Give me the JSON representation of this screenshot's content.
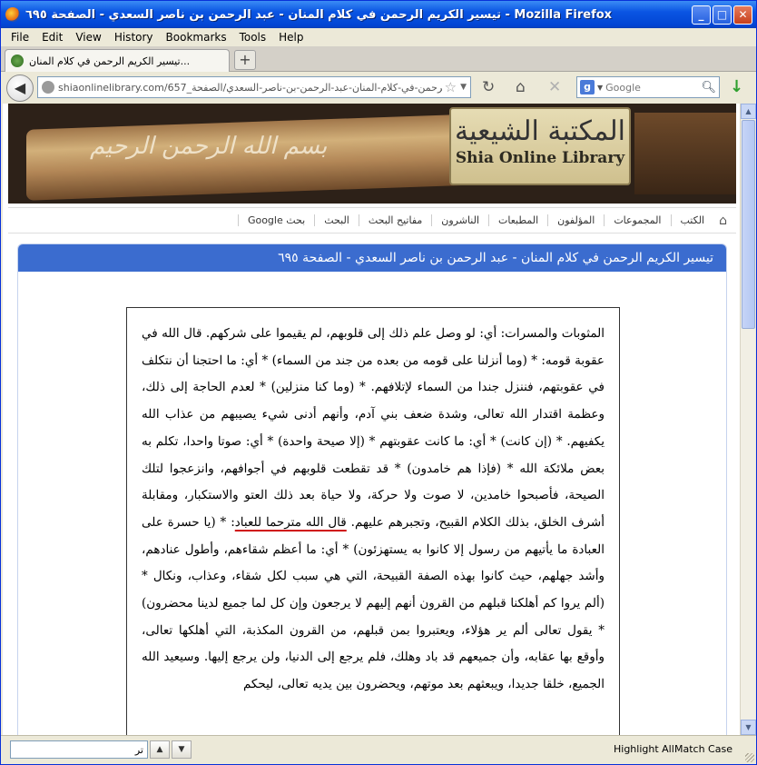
{
  "window": {
    "title": "تيسير الكريم الرحمن في كلام المنان - عبد الرحمن بن ناصر السعدي - الصفحة ٦٩٥ - Mozilla Firefox",
    "min_label": "_",
    "max_label": "□",
    "close_label": "✕"
  },
  "menubar": {
    "items": [
      "File",
      "Edit",
      "View",
      "History",
      "Bookmarks",
      "Tools",
      "Help"
    ]
  },
  "tabs": {
    "active_title": "تيسير الكريم الرحمن في كلام المنان...",
    "new_tab_label": "+"
  },
  "navbar": {
    "url": "shiaonlinelibrary.com/657_تيسير-الكريم-الرحمن-في-كلام-المنان-عبد-الرحمن-بن-ناصر-السعدي/الصفحة",
    "search_placeholder": "Google",
    "search_engine_letter": "g"
  },
  "banner": {
    "calligraphy": "بسم الله الرحمن الرحيم",
    "logo_arabic": "المكتبة الشيعية",
    "logo_english": "Shia Online Library"
  },
  "sitenav": {
    "items": [
      "الكتب",
      "المجموعات",
      "المؤلفون",
      "المطبعات",
      "الناشرون",
      "مفاتيح البحث",
      "البحث",
      "بحث Google"
    ]
  },
  "page": {
    "header": "تيسير الكريم الرحمن في كلام المنان - عبد الرحمن بن ناصر السعدي - الصفحة ٦٩٥",
    "text_before": "المثوبات والمسرات: أي: لو وصل علم ذلك إلى قلوبهم، لم يقيموا على شركهم. قال الله في عقوبة قومه: * (وما أنزلنا على قومه من بعده من جند من السماء) * أي: ما احتجنا أن نتكلف في عقوبتهم، فننزل جندا من السماء لإتلافهم. * (وما كنا منزلين) * لعدم الحاجة إلى ذلك، وعظمة اقتدار الله تعالى، وشدة ضعف بني آدم، وأنهم أدنى شيء يصيبهم من عذاب الله يكفيهم. * (إن كانت) * أي: ما كانت عقوبتهم * (إلا صيحة واحدة) * أي: صوتا واحدا، تكلم به بعض ملائكة الله * (فإذا هم خامدون) * قد تقطعت قلوبهم في أجوافهم، وانزعجوا لتلك الصيحة، فأصبحوا خامدين، لا صوت ولا حركة، ولا حياة بعد ذلك العتو والاستكبار، ومقابلة أشرف الخلق، بذلك الكلام القبيح، وتجبرهم عليهم. ",
    "text_underlined": "قال الله مترحما للعباد",
    "text_after": ": * (يا حسرة على العبادة ما يأتيهم من رسول إلا كانوا به يستهزئون) * أي: ما أعظم شقاءهم، وأطول عنادهم، وأشد جهلهم، حيث كانوا بهذه الصفة القبيحة، التي هي سبب لكل شقاء، وعذاب، ونكال * (ألم يروا كم أهلكنا قبلهم من القرون أنهم إليهم لا يرجعون وإن كل لما جميع لدينا محضرون) * يقول تعالى ألم ير هؤلاء، ويعتبروا بمن قبلهم، من القرون المكذبة، التي أهلكها تعالى، وأوقع بها عقابه، وأن جميعهم قد باد وهلك، فلم يرجع إلى الدنيا، ولن يرجع إليها. وسيعيد الله الجميع، خلقا جديدا، ويبعثهم بعد موتهم، ويحضرون بين يديه تعالى، ليحكم"
  },
  "findbar": {
    "query": "تر",
    "highlight_all": "Highlight All",
    "match_case": "Match Case"
  }
}
